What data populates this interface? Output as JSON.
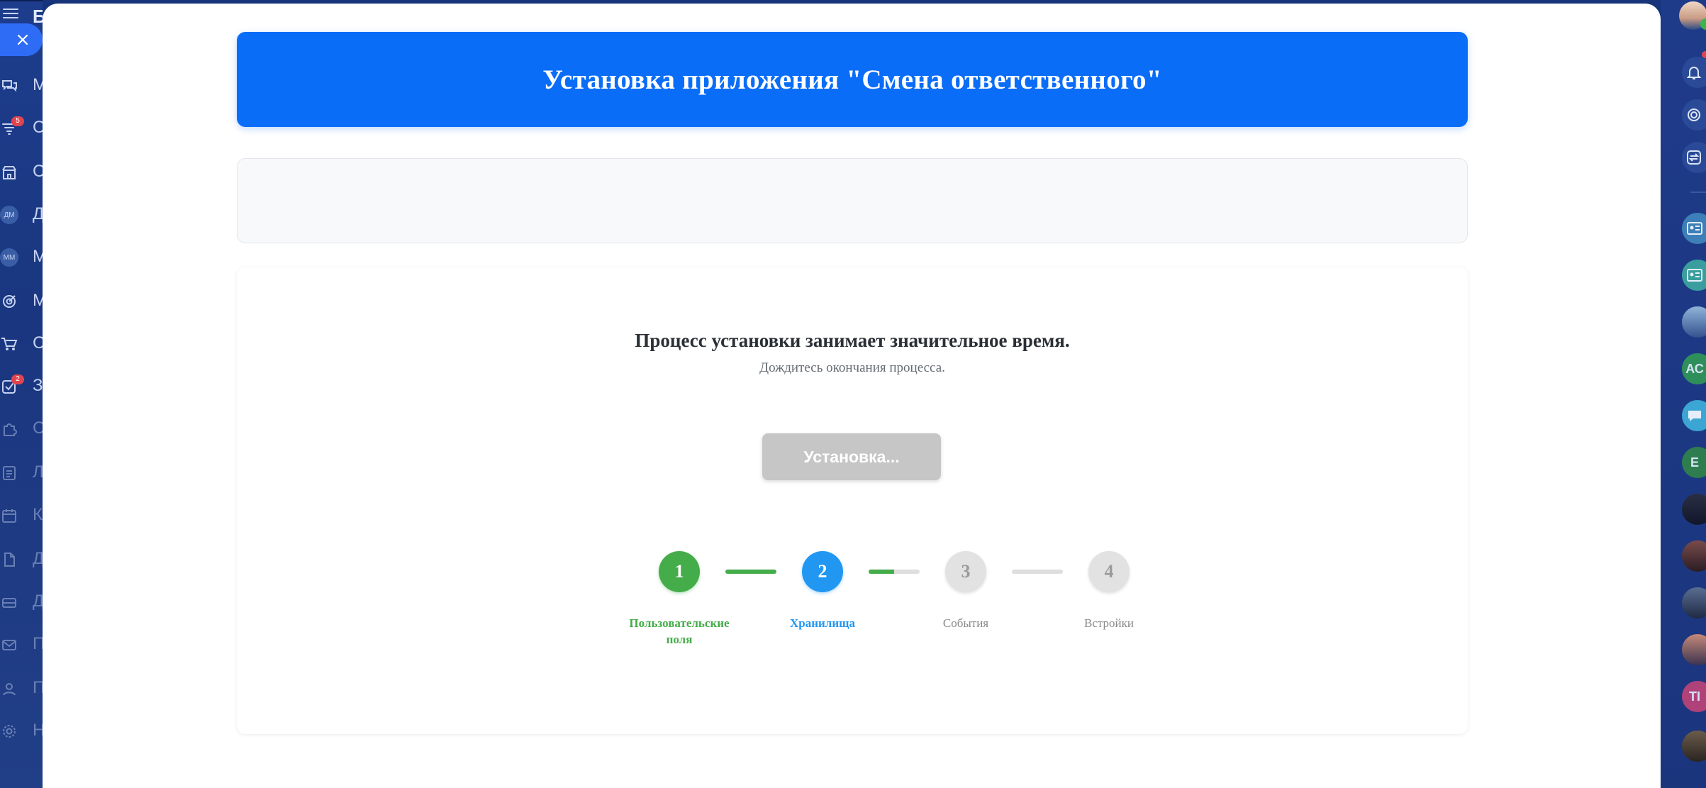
{
  "app": {
    "portal_initial": "Б",
    "header_title": "Установка приложения \"Смена ответственного\""
  },
  "left_sidebar": {
    "items": [
      {
        "label": "М",
        "icon": "chat-icon",
        "count": ""
      },
      {
        "label": "С",
        "icon": "funnel-icon",
        "count": "5"
      },
      {
        "label": "С",
        "icon": "shop-icon",
        "count": ""
      },
      {
        "label": "Д",
        "icon": "avatar-dm",
        "avatar_text": "ДМ",
        "count": ""
      },
      {
        "label": "М",
        "icon": "avatar-mm",
        "avatar_text": "ММ",
        "count": ""
      },
      {
        "label": "М",
        "icon": "target-icon",
        "count": ""
      },
      {
        "label": "С",
        "icon": "cart-icon",
        "count": ""
      },
      {
        "label": "З",
        "icon": "tasks-icon",
        "count": "2"
      },
      {
        "label": "С",
        "icon": "puzzle-icon",
        "count": ""
      },
      {
        "label": "Л",
        "icon": "list-icon",
        "count": ""
      },
      {
        "label": "К",
        "icon": "calendar-icon",
        "count": ""
      },
      {
        "label": "Д",
        "icon": "document-icon",
        "count": ""
      },
      {
        "label": "Д",
        "icon": "drive-icon",
        "count": ""
      },
      {
        "label": "П",
        "icon": "mail-icon",
        "count": ""
      },
      {
        "label": "П",
        "icon": "people-icon",
        "count": ""
      },
      {
        "label": "Н",
        "icon": "gear-icon",
        "count": ""
      }
    ]
  },
  "right_panel": {
    "avatars": [
      {
        "text": "АС",
        "color": "#2f8f5b"
      },
      {
        "text": "Е",
        "color": "#2e7d4f"
      },
      {
        "text": "TI",
        "color": "#b0427a"
      }
    ]
  },
  "install": {
    "title": "Процесс установки занимает значительное время.",
    "subtitle": "Дождитесь окончания процесса.",
    "button_label": "Установка..."
  },
  "steps": [
    {
      "number": "1",
      "label": "Пользовательские поля",
      "state": "done"
    },
    {
      "number": "2",
      "label": "Хранилища",
      "state": "active"
    },
    {
      "number": "3",
      "label": "События",
      "state": "pending"
    },
    {
      "number": "4",
      "label": "Встройки",
      "state": "pending"
    }
  ],
  "connectors": [
    {
      "progress": 1.0
    },
    {
      "progress": 0.5
    },
    {
      "progress": 0.0
    }
  ],
  "colors": {
    "header_blue": "#0a6df8",
    "done_green": "#44ad4a",
    "active_blue": "#2197f2",
    "pending_gray": "#e2e2e2",
    "button_disabled": "#c6c6c6"
  }
}
